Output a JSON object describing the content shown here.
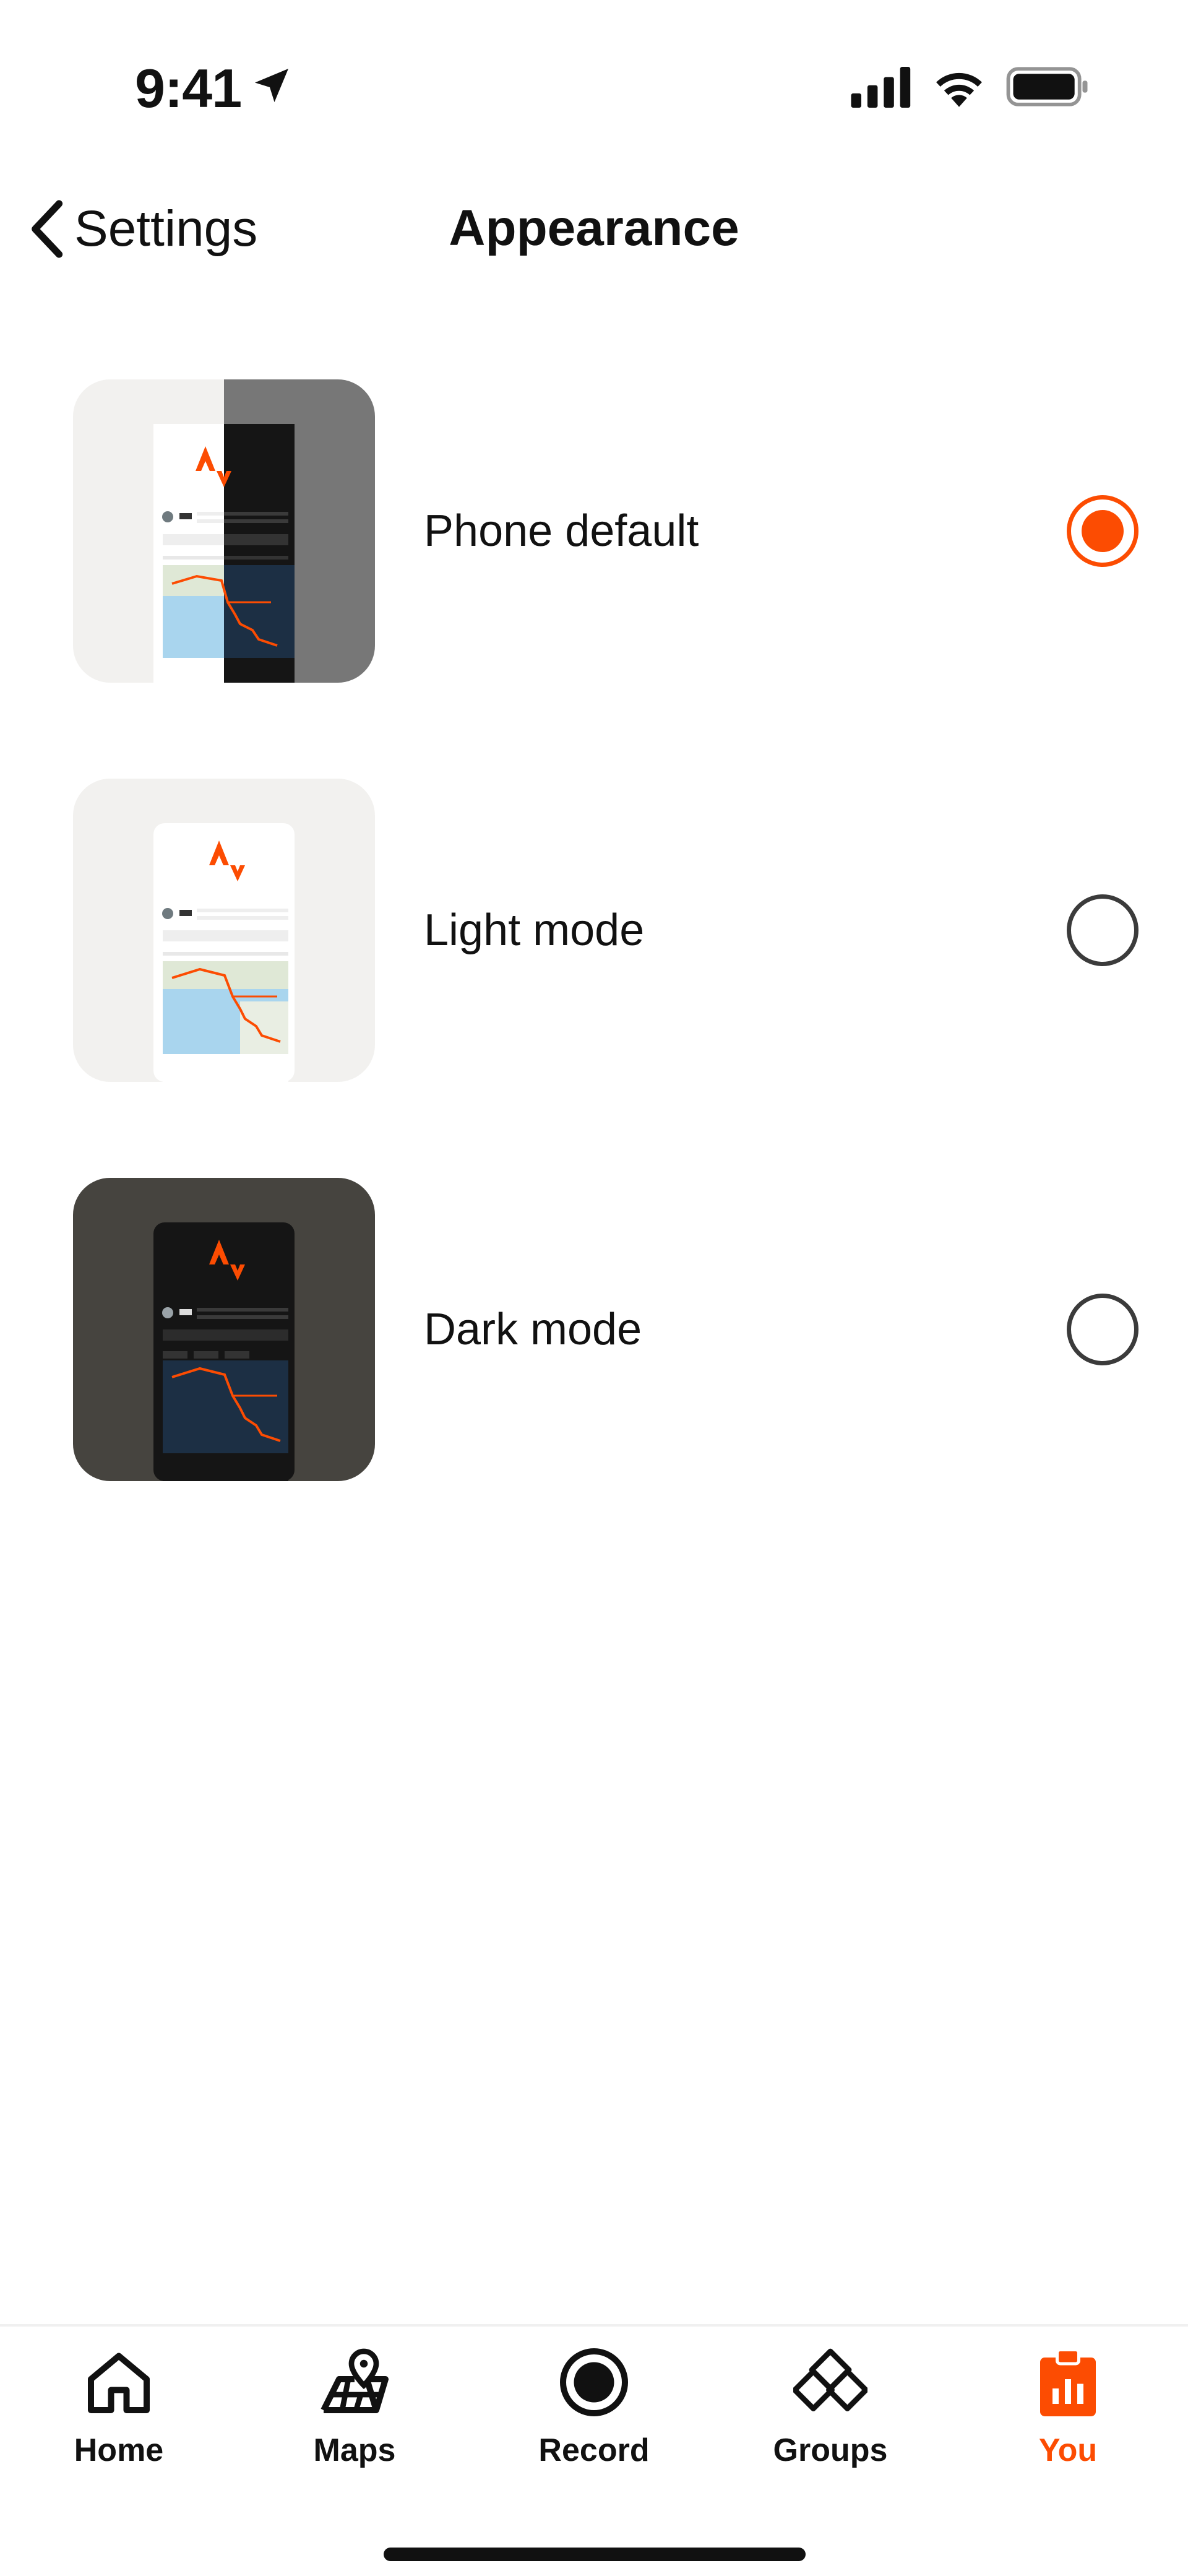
{
  "status_bar": {
    "time": "9:41"
  },
  "header": {
    "back_label": "Settings",
    "title": "Appearance"
  },
  "options": [
    {
      "label": "Phone default",
      "selected": true
    },
    {
      "label": "Light mode",
      "selected": false
    },
    {
      "label": "Dark mode",
      "selected": false
    }
  ],
  "tabs": [
    {
      "label": "Home",
      "active": false
    },
    {
      "label": "Maps",
      "active": false
    },
    {
      "label": "Record",
      "active": false
    },
    {
      "label": "Groups",
      "active": false
    },
    {
      "label": "You",
      "active": true
    }
  ],
  "colors": {
    "accent": "#FC4C02",
    "text": "#111111",
    "light_bg": "#F2F1EF",
    "dark_bg": "#46443F",
    "split_dark": "#777777"
  }
}
